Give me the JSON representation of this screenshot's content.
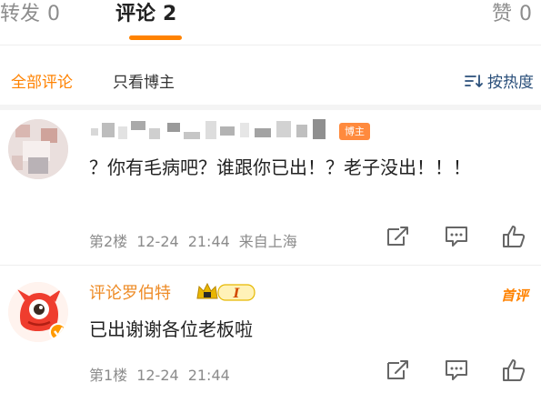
{
  "tabs": {
    "repost": {
      "label": "转发",
      "count": "0"
    },
    "comment": {
      "label": "评论",
      "count": "2"
    },
    "like": {
      "label": "赞",
      "count": "0"
    }
  },
  "filter": {
    "all_label": "全部评论",
    "blogger_only_label": "只看博主",
    "sort_label": "按热度"
  },
  "comments": [
    {
      "badge": "博主",
      "text": "？你有毛病吧？谁跟你已出！？老子没出！！！",
      "floor": "第2楼",
      "date": "12-24",
      "time": "21:44",
      "location": "来自上海"
    },
    {
      "name": "评论罗伯特",
      "level": "I",
      "top_badge": "首评",
      "text": "已出谢谢各位老板啦",
      "floor": "第1楼",
      "date": "12-24",
      "time": "21:44"
    }
  ],
  "colors": {
    "accent": "#ff8200",
    "link": "#2a4f7a",
    "meta": "#8b8b8b",
    "name": "#ee8b26"
  },
  "icons": [
    "sort-icon",
    "repost-icon",
    "comment-icon",
    "like-icon",
    "crown-icon"
  ]
}
